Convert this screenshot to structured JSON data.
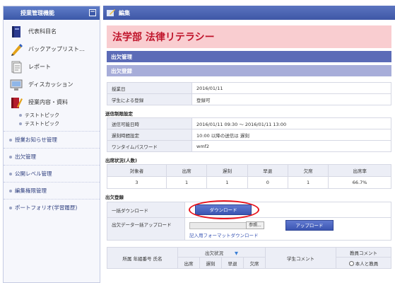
{
  "sidebar": {
    "header": "授業管理機能",
    "collapse": "−",
    "items": [
      {
        "label": "代表科目名",
        "icon": "book-icon"
      },
      {
        "label": "バックアップリスト…",
        "icon": "pen-icon"
      },
      {
        "label": "レポート",
        "icon": "document-icon"
      },
      {
        "label": "ディスカッション",
        "icon": "computer-icon"
      },
      {
        "label": "授業内容・資料",
        "icon": "book-pencil-icon"
      }
    ],
    "subitems": [
      "テストトピック",
      "テストトピック"
    ],
    "links": [
      "授業お知らせ管理",
      "出欠管理",
      "公開レベル管理",
      "編集権限管理",
      "ポートフォリオ(学習履歴)"
    ]
  },
  "header": {
    "title": "編集"
  },
  "course": {
    "title": "法学部 法律リテラシー"
  },
  "attendance": {
    "section": "出欠管理",
    "registration": "出欠登録",
    "class_date_label": "授業日",
    "class_date": "2016/01/11",
    "student_reg_label": "学生による登録",
    "student_reg": "登録可",
    "send_limit_title": "送信制限設定",
    "send_period_label": "送信可能日時",
    "send_period": "2016/01/11 09:30 〜 2016/01/11 13:00",
    "late_label": "遅刻時間設定",
    "late_value": "10:00 以降の送信は 遅刻",
    "otp_label": "ワンタイムパスワード",
    "otp_value": "wmf2",
    "status_title": "出席状況(人数)",
    "status_headers": [
      "対象者",
      "出席",
      "遅刻",
      "早退",
      "欠席",
      "出席率"
    ],
    "status_values": [
      "3",
      "1",
      "1",
      "0",
      "1",
      "66.7%"
    ],
    "reg_title": "出欠登録",
    "bulk_dl_label": "一括ダウンロード",
    "download_button": "ダウンロード",
    "bulk_ul_label": "出欠データ一括アップロード",
    "browse_button": "参照...",
    "upload_button": "アップロード",
    "format_link": "記入用フォーマットダウンロード",
    "list_headers": {
      "student": "所属 年組番号 氏名",
      "status": "出欠状況",
      "sub": [
        "出席",
        "遅刻",
        "早退",
        "欠席"
      ],
      "comment": "学生コメント",
      "teacher_comment": "教員コメント",
      "option": "本人と教員"
    }
  }
}
